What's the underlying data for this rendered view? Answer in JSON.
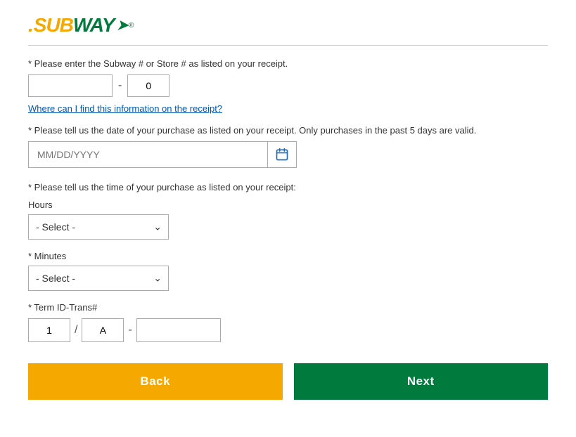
{
  "logo": {
    "dot": ".",
    "sub": "SUB",
    "way": "WAY",
    "arrow": "➤",
    "reg": "®"
  },
  "store_section": {
    "label": "* Please enter the Subway # or Store # as listed on your receipt.",
    "store_placeholder": "",
    "separator": "-",
    "store_default_value": "0",
    "help_link": "Where can I find this information on the receipt?"
  },
  "date_section": {
    "label": "* Please tell us the date of your purchase as listed on your receipt. Only purchases in the past 5 days are valid.",
    "date_placeholder": "MM/DD/YYYY"
  },
  "time_section": {
    "label": "* Please tell us the time of your purchase as listed on your receipt:",
    "hours_label": "Hours",
    "hours_default": "- Select -",
    "minutes_label": "* Minutes",
    "minutes_default": "- Select -"
  },
  "term_section": {
    "label": "* Term ID-Trans#",
    "field1_value": "1",
    "field2_value": "A",
    "separator1": "/",
    "separator2": "-",
    "field3_value": ""
  },
  "buttons": {
    "back_label": "Back",
    "next_label": "Next"
  }
}
